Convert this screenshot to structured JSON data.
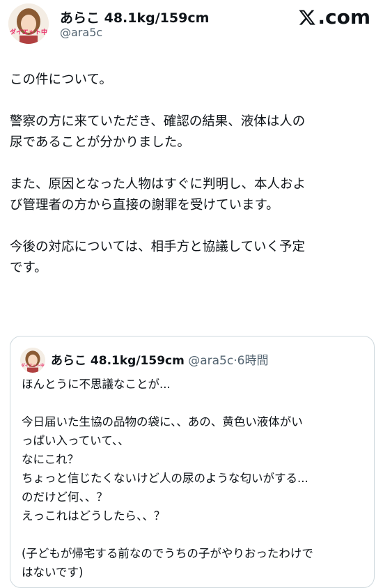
{
  "author": {
    "display_name": "あらこ 48.1kg/159cm",
    "handle": "@ara5c",
    "avatar_badge": "ダイエット中"
  },
  "brand": {
    "logo_text": ".com",
    "logo_icon": "x-logo-icon"
  },
  "post": {
    "paragraphs": [
      [
        "この件について。"
      ],
      [
        "警察の方に来ていただき、確認の結果、液体は人の",
        "尿であることが分かりました。"
      ],
      [
        "また、原因となった人物はすぐに判明し、本人およ",
        "び管理者の方から直接の謝罪を受けています。"
      ],
      [
        "今後の対応については、相手方と協議していく予定",
        "です。"
      ]
    ]
  },
  "quoted_post": {
    "display_name": "あらこ 48.1kg/159cm",
    "handle": "@ara5c",
    "separator": "·",
    "time": "6時間",
    "paragraphs": [
      [
        "ほんとうに不思議なことが..."
      ],
      [
        "今日届いた生協の品物の袋に、、あの、黄色い液体がい",
        "っぱい入っていて、、",
        "なにこれ？",
        "ちょっと信じたくないけど人の尿のような匂いがする...",
        "のだけど何、、？",
        "えっこれはどうしたら、、？"
      ],
      [
        "(子どもが帰宅する前なのでうちの子がやりおったわけで",
        "はないです)"
      ]
    ]
  },
  "colors": {
    "text": "#0f1419",
    "secondary": "#536471",
    "border": "#cfd9de",
    "badge": "#e8326b"
  }
}
